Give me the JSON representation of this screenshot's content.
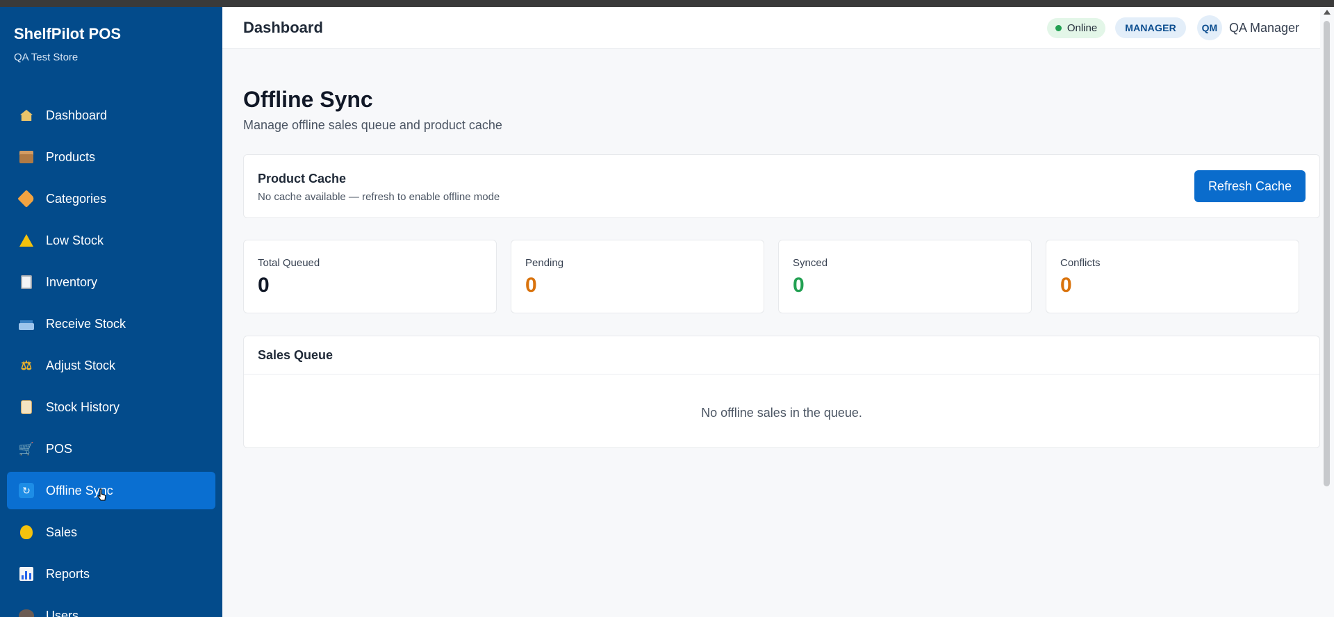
{
  "app": {
    "name": "ShelfPilot POS",
    "store": "QA Test Store"
  },
  "sidebar": {
    "items": [
      {
        "label": "Dashboard",
        "icon": "house-icon"
      },
      {
        "label": "Products",
        "icon": "box-icon"
      },
      {
        "label": "Categories",
        "icon": "tag-icon"
      },
      {
        "label": "Low Stock",
        "icon": "warning-icon"
      },
      {
        "label": "Inventory",
        "icon": "clipboard-icon"
      },
      {
        "label": "Receive Stock",
        "icon": "inbox-tray-icon"
      },
      {
        "label": "Adjust Stock",
        "icon": "balance-scale-icon"
      },
      {
        "label": "Stock History",
        "icon": "scroll-icon"
      },
      {
        "label": "POS",
        "icon": "cart-icon"
      },
      {
        "label": "Offline Sync",
        "icon": "sync-icon",
        "active": true
      },
      {
        "label": "Sales",
        "icon": "money-bag-icon"
      },
      {
        "label": "Reports",
        "icon": "bar-chart-icon"
      },
      {
        "label": "Users",
        "icon": "users-icon"
      }
    ]
  },
  "header": {
    "title": "Dashboard",
    "status": "Online",
    "role": "MANAGER",
    "avatar_initials": "QM",
    "user_name": "QA Manager"
  },
  "page": {
    "title": "Offline Sync",
    "subtitle": "Manage offline sales queue and product cache"
  },
  "cache": {
    "title": "Product Cache",
    "status": "No cache available — refresh to enable offline mode",
    "refresh_label": "Refresh Cache"
  },
  "stats": [
    {
      "label": "Total Queued",
      "value": "0",
      "color": "#111827"
    },
    {
      "label": "Pending",
      "value": "0",
      "color": "#d9730d"
    },
    {
      "label": "Synced",
      "value": "0",
      "color": "#22a052"
    },
    {
      "label": "Conflicts",
      "value": "0",
      "color": "#d9730d"
    }
  ],
  "queue": {
    "title": "Sales Queue",
    "empty_message": "No offline sales in the queue."
  },
  "colors": {
    "sidebar_bg": "#034b8b",
    "active_item": "#0a6fd1",
    "primary_button": "#0a6ccc",
    "online_dot": "#22a052"
  }
}
